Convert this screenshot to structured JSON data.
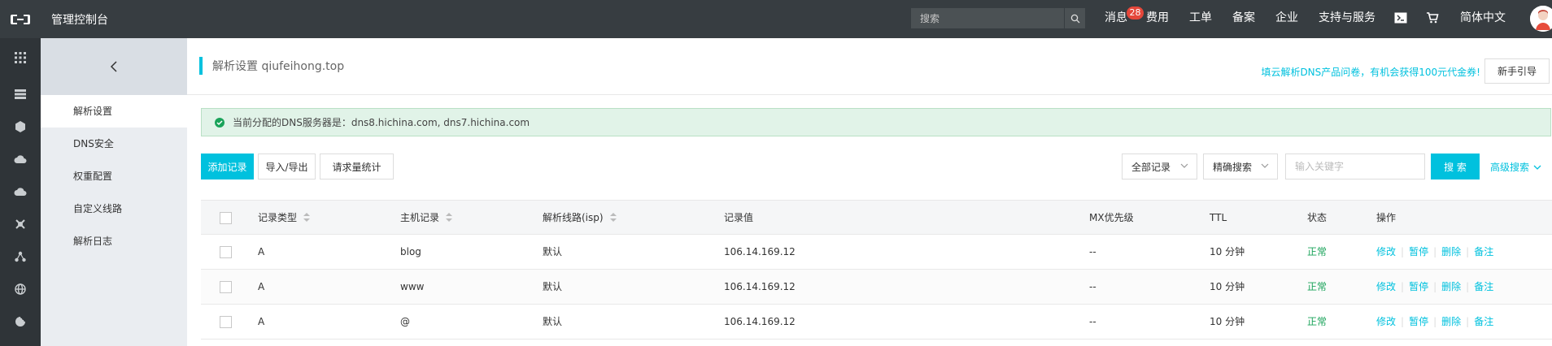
{
  "topbar": {
    "console_title": "管理控制台",
    "search_placeholder": "搜索",
    "nav": {
      "messages": "消息",
      "messages_count": "28",
      "billing": "费用",
      "tickets": "工单",
      "icp": "备案",
      "enterprise": "企业",
      "support": "支持与服务",
      "language": "简体中文"
    }
  },
  "rail": {
    "icons": [
      "grid-icon",
      "server-icon",
      "cube-icon",
      "cloud-icon",
      "cloud-upload-icon",
      "cross-icon",
      "network-icon",
      "globe-icon",
      "cookie-icon"
    ]
  },
  "sidebar": {
    "items": [
      {
        "label": "解析设置"
      },
      {
        "label": "DNS安全"
      },
      {
        "label": "权重配置"
      },
      {
        "label": "自定义线路"
      },
      {
        "label": "解析日志"
      }
    ]
  },
  "page": {
    "title": "解析设置 qiufeihong.top",
    "promo": "填云解析DNS产品问卷，有机会获得100元代金券!",
    "guide_button": "新手引导",
    "notice": "当前分配的DNS服务器是：dns8.hichina.com, dns7.hichina.com"
  },
  "toolbar": {
    "add_record": "添加记录",
    "import_export": "导入/导出",
    "request_stats": "请求量统计",
    "record_filter": "全部记录",
    "search_mode": "精确搜索",
    "keyword_placeholder": "输入关键字",
    "search_button": "搜 索",
    "advanced_search": "高级搜索"
  },
  "table": {
    "headers": {
      "type": "记录类型",
      "host": "主机记录",
      "line": "解析线路(isp)",
      "value": "记录值",
      "mx": "MX优先级",
      "ttl": "TTL",
      "status": "状态",
      "actions": "操作"
    },
    "rows": [
      {
        "type": "A",
        "host": "blog",
        "line": "默认",
        "value": "106.14.169.12",
        "mx": "--",
        "ttl": "10 分钟",
        "status": "正常"
      },
      {
        "type": "A",
        "host": "www",
        "line": "默认",
        "value": "106.14.169.12",
        "mx": "--",
        "ttl": "10 分钟",
        "status": "正常"
      },
      {
        "type": "A",
        "host": "@",
        "line": "默认",
        "value": "106.14.169.12",
        "mx": "--",
        "ttl": "10 分钟",
        "status": "正常"
      }
    ],
    "actions": {
      "edit": "修改",
      "pause": "暂停",
      "delete": "删除",
      "note": "备注"
    }
  },
  "colors": {
    "topbar_bg": "#373d41",
    "accent": "#00c1de",
    "success": "#1aa35a",
    "badge": "#e5473a"
  }
}
